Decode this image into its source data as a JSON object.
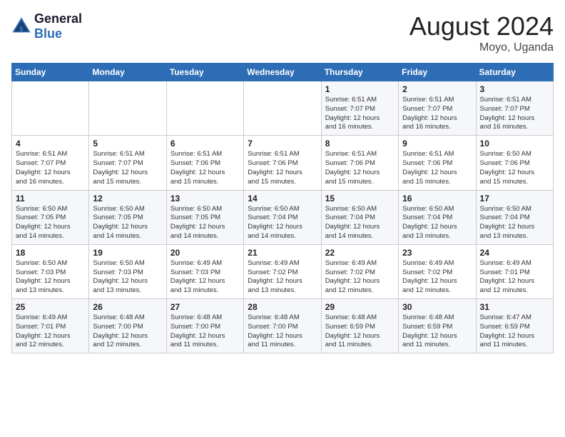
{
  "header": {
    "logo_line1": "General",
    "logo_line2": "Blue",
    "month_year": "August 2024",
    "location": "Moyo, Uganda"
  },
  "weekdays": [
    "Sunday",
    "Monday",
    "Tuesday",
    "Wednesday",
    "Thursday",
    "Friday",
    "Saturday"
  ],
  "weeks": [
    [
      {
        "day": "",
        "info": ""
      },
      {
        "day": "",
        "info": ""
      },
      {
        "day": "",
        "info": ""
      },
      {
        "day": "",
        "info": ""
      },
      {
        "day": "1",
        "info": "Sunrise: 6:51 AM\nSunset: 7:07 PM\nDaylight: 12 hours\nand 16 minutes."
      },
      {
        "day": "2",
        "info": "Sunrise: 6:51 AM\nSunset: 7:07 PM\nDaylight: 12 hours\nand 16 minutes."
      },
      {
        "day": "3",
        "info": "Sunrise: 6:51 AM\nSunset: 7:07 PM\nDaylight: 12 hours\nand 16 minutes."
      }
    ],
    [
      {
        "day": "4",
        "info": "Sunrise: 6:51 AM\nSunset: 7:07 PM\nDaylight: 12 hours\nand 16 minutes."
      },
      {
        "day": "5",
        "info": "Sunrise: 6:51 AM\nSunset: 7:07 PM\nDaylight: 12 hours\nand 15 minutes."
      },
      {
        "day": "6",
        "info": "Sunrise: 6:51 AM\nSunset: 7:06 PM\nDaylight: 12 hours\nand 15 minutes."
      },
      {
        "day": "7",
        "info": "Sunrise: 6:51 AM\nSunset: 7:06 PM\nDaylight: 12 hours\nand 15 minutes."
      },
      {
        "day": "8",
        "info": "Sunrise: 6:51 AM\nSunset: 7:06 PM\nDaylight: 12 hours\nand 15 minutes."
      },
      {
        "day": "9",
        "info": "Sunrise: 6:51 AM\nSunset: 7:06 PM\nDaylight: 12 hours\nand 15 minutes."
      },
      {
        "day": "10",
        "info": "Sunrise: 6:50 AM\nSunset: 7:06 PM\nDaylight: 12 hours\nand 15 minutes."
      }
    ],
    [
      {
        "day": "11",
        "info": "Sunrise: 6:50 AM\nSunset: 7:05 PM\nDaylight: 12 hours\nand 14 minutes."
      },
      {
        "day": "12",
        "info": "Sunrise: 6:50 AM\nSunset: 7:05 PM\nDaylight: 12 hours\nand 14 minutes."
      },
      {
        "day": "13",
        "info": "Sunrise: 6:50 AM\nSunset: 7:05 PM\nDaylight: 12 hours\nand 14 minutes."
      },
      {
        "day": "14",
        "info": "Sunrise: 6:50 AM\nSunset: 7:04 PM\nDaylight: 12 hours\nand 14 minutes."
      },
      {
        "day": "15",
        "info": "Sunrise: 6:50 AM\nSunset: 7:04 PM\nDaylight: 12 hours\nand 14 minutes."
      },
      {
        "day": "16",
        "info": "Sunrise: 6:50 AM\nSunset: 7:04 PM\nDaylight: 12 hours\nand 13 minutes."
      },
      {
        "day": "17",
        "info": "Sunrise: 6:50 AM\nSunset: 7:04 PM\nDaylight: 12 hours\nand 13 minutes."
      }
    ],
    [
      {
        "day": "18",
        "info": "Sunrise: 6:50 AM\nSunset: 7:03 PM\nDaylight: 12 hours\nand 13 minutes."
      },
      {
        "day": "19",
        "info": "Sunrise: 6:50 AM\nSunset: 7:03 PM\nDaylight: 12 hours\nand 13 minutes."
      },
      {
        "day": "20",
        "info": "Sunrise: 6:49 AM\nSunset: 7:03 PM\nDaylight: 12 hours\nand 13 minutes."
      },
      {
        "day": "21",
        "info": "Sunrise: 6:49 AM\nSunset: 7:02 PM\nDaylight: 12 hours\nand 13 minutes."
      },
      {
        "day": "22",
        "info": "Sunrise: 6:49 AM\nSunset: 7:02 PM\nDaylight: 12 hours\nand 12 minutes."
      },
      {
        "day": "23",
        "info": "Sunrise: 6:49 AM\nSunset: 7:02 PM\nDaylight: 12 hours\nand 12 minutes."
      },
      {
        "day": "24",
        "info": "Sunrise: 6:49 AM\nSunset: 7:01 PM\nDaylight: 12 hours\nand 12 minutes."
      }
    ],
    [
      {
        "day": "25",
        "info": "Sunrise: 6:49 AM\nSunset: 7:01 PM\nDaylight: 12 hours\nand 12 minutes."
      },
      {
        "day": "26",
        "info": "Sunrise: 6:48 AM\nSunset: 7:00 PM\nDaylight: 12 hours\nand 12 minutes."
      },
      {
        "day": "27",
        "info": "Sunrise: 6:48 AM\nSunset: 7:00 PM\nDaylight: 12 hours\nand 11 minutes."
      },
      {
        "day": "28",
        "info": "Sunrise: 6:48 AM\nSunset: 7:00 PM\nDaylight: 12 hours\nand 11 minutes."
      },
      {
        "day": "29",
        "info": "Sunrise: 6:48 AM\nSunset: 6:59 PM\nDaylight: 12 hours\nand 11 minutes."
      },
      {
        "day": "30",
        "info": "Sunrise: 6:48 AM\nSunset: 6:59 PM\nDaylight: 12 hours\nand 11 minutes."
      },
      {
        "day": "31",
        "info": "Sunrise: 6:47 AM\nSunset: 6:59 PM\nDaylight: 12 hours\nand 11 minutes."
      }
    ]
  ]
}
